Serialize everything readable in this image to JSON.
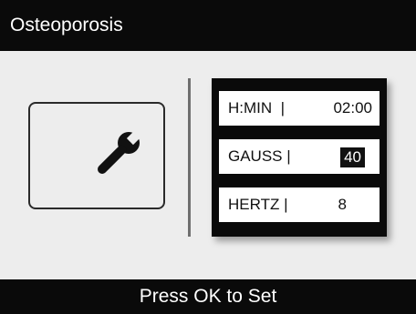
{
  "title": "Osteoporosis",
  "icon": "wrench-icon",
  "params": [
    {
      "label": "H:MIN",
      "separator": "|",
      "value": "02:00"
    },
    {
      "label": "GAUSS",
      "separator": "|",
      "value": "40",
      "selected": true
    },
    {
      "label": "HERTZ",
      "separator": "|",
      "value": "8"
    }
  ],
  "footer": "Press OK to Set",
  "colors": {
    "bar": "#0a0a0a",
    "background": "#ededed",
    "field": "#ffffff",
    "selection": "#111111"
  }
}
